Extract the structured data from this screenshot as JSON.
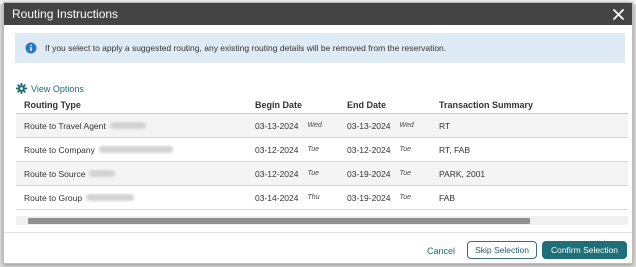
{
  "dialog": {
    "title": "Routing Instructions",
    "close_icon": "close-icon"
  },
  "info": {
    "icon": "info-circle-icon",
    "message": "If you select to apply a suggested routing, any existing routing details will be removed from the reservation."
  },
  "view_options": {
    "icon": "gear-icon",
    "label": "View Options"
  },
  "table": {
    "headers": [
      "Routing Type",
      "Begin Date",
      "End Date",
      "Transaction Summary"
    ],
    "rows": [
      {
        "type": "Route to Travel Agent",
        "begin": "03-13-2024",
        "begin_day": "Wed",
        "end": "03-13-2024",
        "end_day": "Wed",
        "summary": "RT"
      },
      {
        "type": "Route to Company",
        "begin": "03-12-2024",
        "begin_day": "Tue",
        "end": "03-12-2024",
        "end_day": "Tue",
        "summary": "RT, FAB"
      },
      {
        "type": "Route to Source",
        "begin": "03-12-2024",
        "begin_day": "Tue",
        "end": "03-19-2024",
        "end_day": "Tue",
        "summary": "PARK, 2001"
      },
      {
        "type": "Route to Group",
        "begin": "03-14-2024",
        "begin_day": "Thu",
        "end": "03-19-2024",
        "end_day": "Tue",
        "summary": "FAB"
      }
    ]
  },
  "footer": {
    "cancel_label": "Cancel",
    "skip_label": "Skip Selection",
    "confirm_label": "Confirm Selection"
  },
  "colors": {
    "titlebar": "#444444",
    "info_bg": "#deeaf4",
    "accent": "#1e6f77",
    "link": "#1f6b75"
  }
}
